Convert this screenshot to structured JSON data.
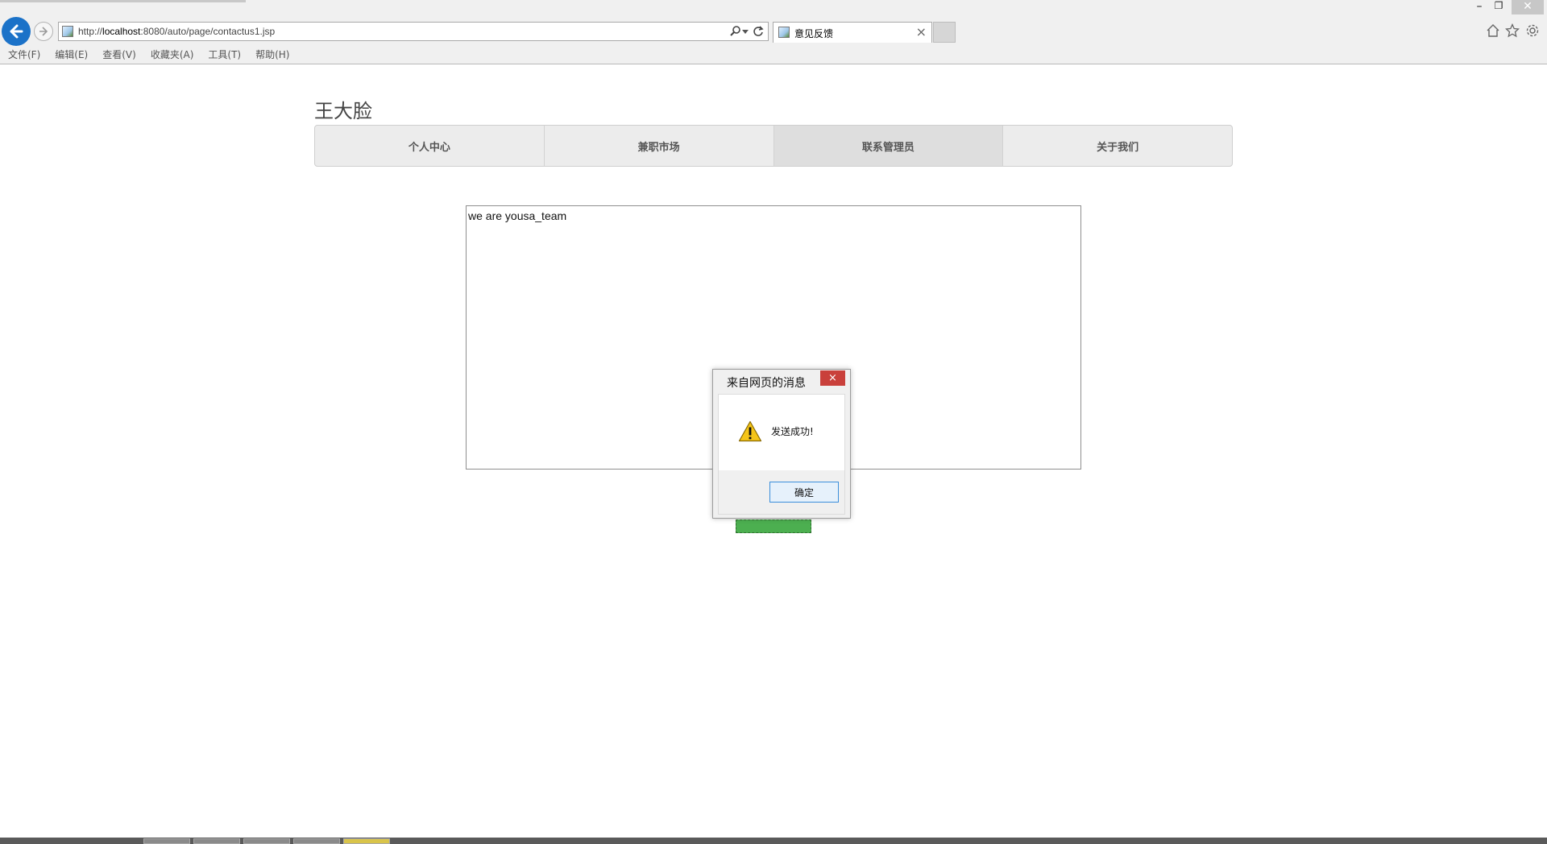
{
  "browser": {
    "url_prefix": "http://",
    "url_host": "localhost",
    "url_rest": ":8080/auto/page/contactus1.jsp",
    "tab_title": "意见反馈",
    "tab_close": "×",
    "menu": [
      "文件(F)",
      "编辑(E)",
      "查看(V)",
      "收藏夹(A)",
      "工具(T)",
      "帮助(H)"
    ],
    "window_controls": {
      "minimize": "–",
      "restore": "❐",
      "close": "✕"
    }
  },
  "page": {
    "site_title": "王大脸",
    "nav": [
      {
        "label": "个人中心",
        "active": false
      },
      {
        "label": "兼职市场",
        "active": false
      },
      {
        "label": "联系管理员",
        "active": true
      },
      {
        "label": "关于我们",
        "active": false
      }
    ],
    "message_value": "we are yousa_team",
    "send_button_color": "#4caf50"
  },
  "dialog": {
    "title": "来自网页的消息",
    "close": "×",
    "message": "发送成功!",
    "ok_label": "确定",
    "icon": "warning-icon"
  },
  "colors": {
    "back_button": "#1b72c8",
    "dialog_close": "#c9403b",
    "ok_border": "#3a8edb"
  }
}
